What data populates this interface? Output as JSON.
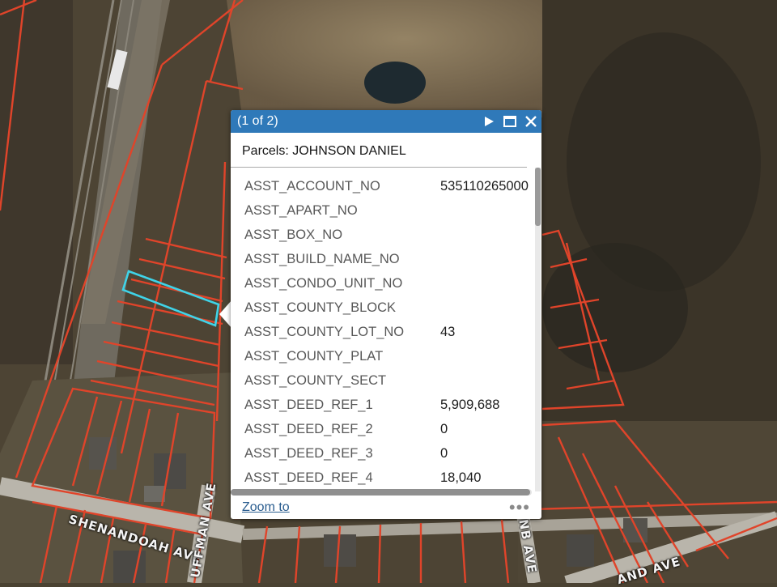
{
  "colors": {
    "parcel_outline": "#e0442a",
    "selected_parcel": "#3fd3e8",
    "popup_header": "#2f79b9",
    "link": "#2a5d8f"
  },
  "map": {
    "road_labels": [
      "SHENANDOAH AVE",
      "UFFMAN AVE",
      "NB AVE",
      "AND AVE"
    ]
  },
  "popup": {
    "counter": "(1 of 2)",
    "icons": [
      "play-icon",
      "maximize-icon",
      "close-icon"
    ],
    "title": "Parcels: JOHNSON DANIEL",
    "attributes": [
      {
        "field": "ASST_ACCOUNT_NO",
        "value": "535110265000"
      },
      {
        "field": "ASST_APART_NO",
        "value": ""
      },
      {
        "field": "ASST_BOX_NO",
        "value": ""
      },
      {
        "field": "ASST_BUILD_NAME_NO",
        "value": ""
      },
      {
        "field": "ASST_CONDO_UNIT_NO",
        "value": ""
      },
      {
        "field": "ASST_COUNTY_BLOCK",
        "value": ""
      },
      {
        "field": "ASST_COUNTY_LOT_NO",
        "value": "43"
      },
      {
        "field": "ASST_COUNTY_PLAT",
        "value": ""
      },
      {
        "field": "ASST_COUNTY_SECT",
        "value": ""
      },
      {
        "field": "ASST_DEED_REF_1",
        "value": "5,909,688"
      },
      {
        "field": "ASST_DEED_REF_2",
        "value": "0"
      },
      {
        "field": "ASST_DEED_REF_3",
        "value": "0"
      },
      {
        "field": "ASST_DEED_REF_4",
        "value": "18,040"
      }
    ],
    "zoom_to_label": "Zoom to",
    "more_label": "•••"
  }
}
